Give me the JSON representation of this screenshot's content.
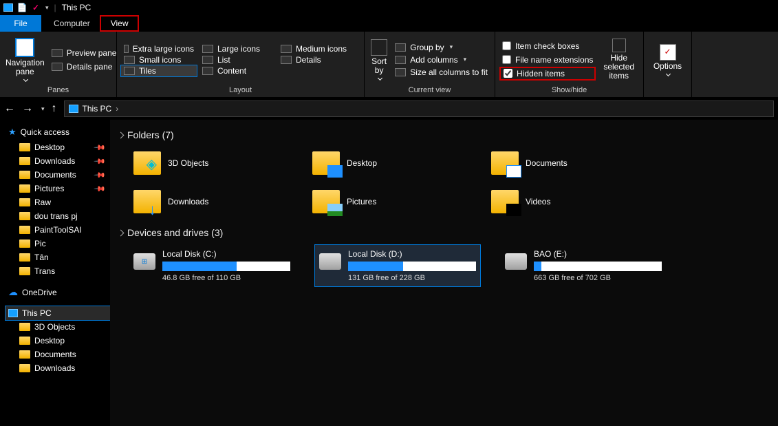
{
  "title": "This PC",
  "tabs": {
    "file": "File",
    "computer": "Computer",
    "view": "View"
  },
  "ribbon": {
    "panes": {
      "nav": "Navigation pane",
      "preview": "Preview pane",
      "details": "Details pane",
      "label": "Panes"
    },
    "layout": {
      "xl": "Extra large icons",
      "lg": "Large icons",
      "md": "Medium icons",
      "sm": "Small icons",
      "list": "List",
      "det": "Details",
      "tiles": "Tiles",
      "content": "Content",
      "label": "Layout"
    },
    "currentview": {
      "sort": "Sort by",
      "group": "Group by",
      "addcol": "Add columns",
      "sizeall": "Size all columns to fit",
      "label": "Current view"
    },
    "showhide": {
      "check": "Item check boxes",
      "ext": "File name extensions",
      "hidden": "Hidden items",
      "hidesel": "Hide selected items",
      "label": "Show/hide"
    },
    "options": "Options"
  },
  "breadcrumb": {
    "root": "This PC"
  },
  "sidebar": {
    "qa": "Quick access",
    "qa_items": [
      "Desktop",
      "Downloads",
      "Documents",
      "Pictures",
      "Raw",
      "dou trans pj",
      "PaintToolSAI",
      "Pic",
      "Tân",
      "Trans"
    ],
    "onedrive": "OneDrive",
    "thispc": "This PC",
    "pc_items": [
      "3D Objects",
      "Desktop",
      "Documents",
      "Downloads"
    ]
  },
  "main": {
    "folders_head": "Folders (7)",
    "folders": [
      "3D Objects",
      "Desktop",
      "Documents",
      "Downloads",
      "Pictures",
      "Videos"
    ],
    "drives_head": "Devices and drives (3)",
    "drives": [
      {
        "name": "Local Disk (C:)",
        "free": "46.8 GB free of 110 GB",
        "pct": 58
      },
      {
        "name": "Local Disk (D:)",
        "free": "131 GB free of 228 GB",
        "pct": 43
      },
      {
        "name": "BAO (E:)",
        "free": "663 GB free of 702 GB",
        "pct": 6
      }
    ]
  }
}
